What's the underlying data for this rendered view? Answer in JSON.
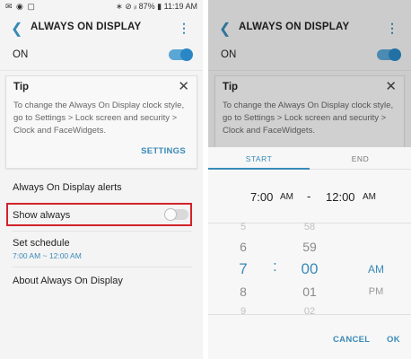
{
  "status": {
    "icons_left": "✉ ◉ ▢",
    "icons_right": "∗ ⊘ ᵢₗ 87% ▮",
    "time": "11:19 AM"
  },
  "header": {
    "title": "ALWAYS ON DISPLAY"
  },
  "on_row": {
    "label": "ON",
    "checked": true
  },
  "tip": {
    "title": "Tip",
    "body": "To change the Always On Display clock style, go to Settings > Lock screen and security > Clock and FaceWidgets.",
    "button": "SETTINGS"
  },
  "items": {
    "alerts": "Always On Display alerts",
    "show_always": "Show always",
    "show_always_checked": false,
    "set_schedule": "Set schedule",
    "schedule_value": "7:00 AM ~ 12:00 AM",
    "about": "About Always On Display"
  },
  "picker": {
    "tab_start": "START",
    "tab_end": "END",
    "start_time": "7:00",
    "start_ampm": "AM",
    "dash": "-",
    "end_time": "12:00",
    "end_ampm": "AM",
    "hours": [
      "5",
      "6",
      "7",
      "8",
      "9"
    ],
    "minutes": [
      "58",
      "59",
      "00",
      "01",
      "02"
    ],
    "colon": ":",
    "ampm_selected": "AM",
    "ampm_other": "PM",
    "cancel": "CANCEL",
    "ok": "OK"
  },
  "colors": {
    "accent": "#3a8ab8",
    "highlight": "#d1232a"
  }
}
